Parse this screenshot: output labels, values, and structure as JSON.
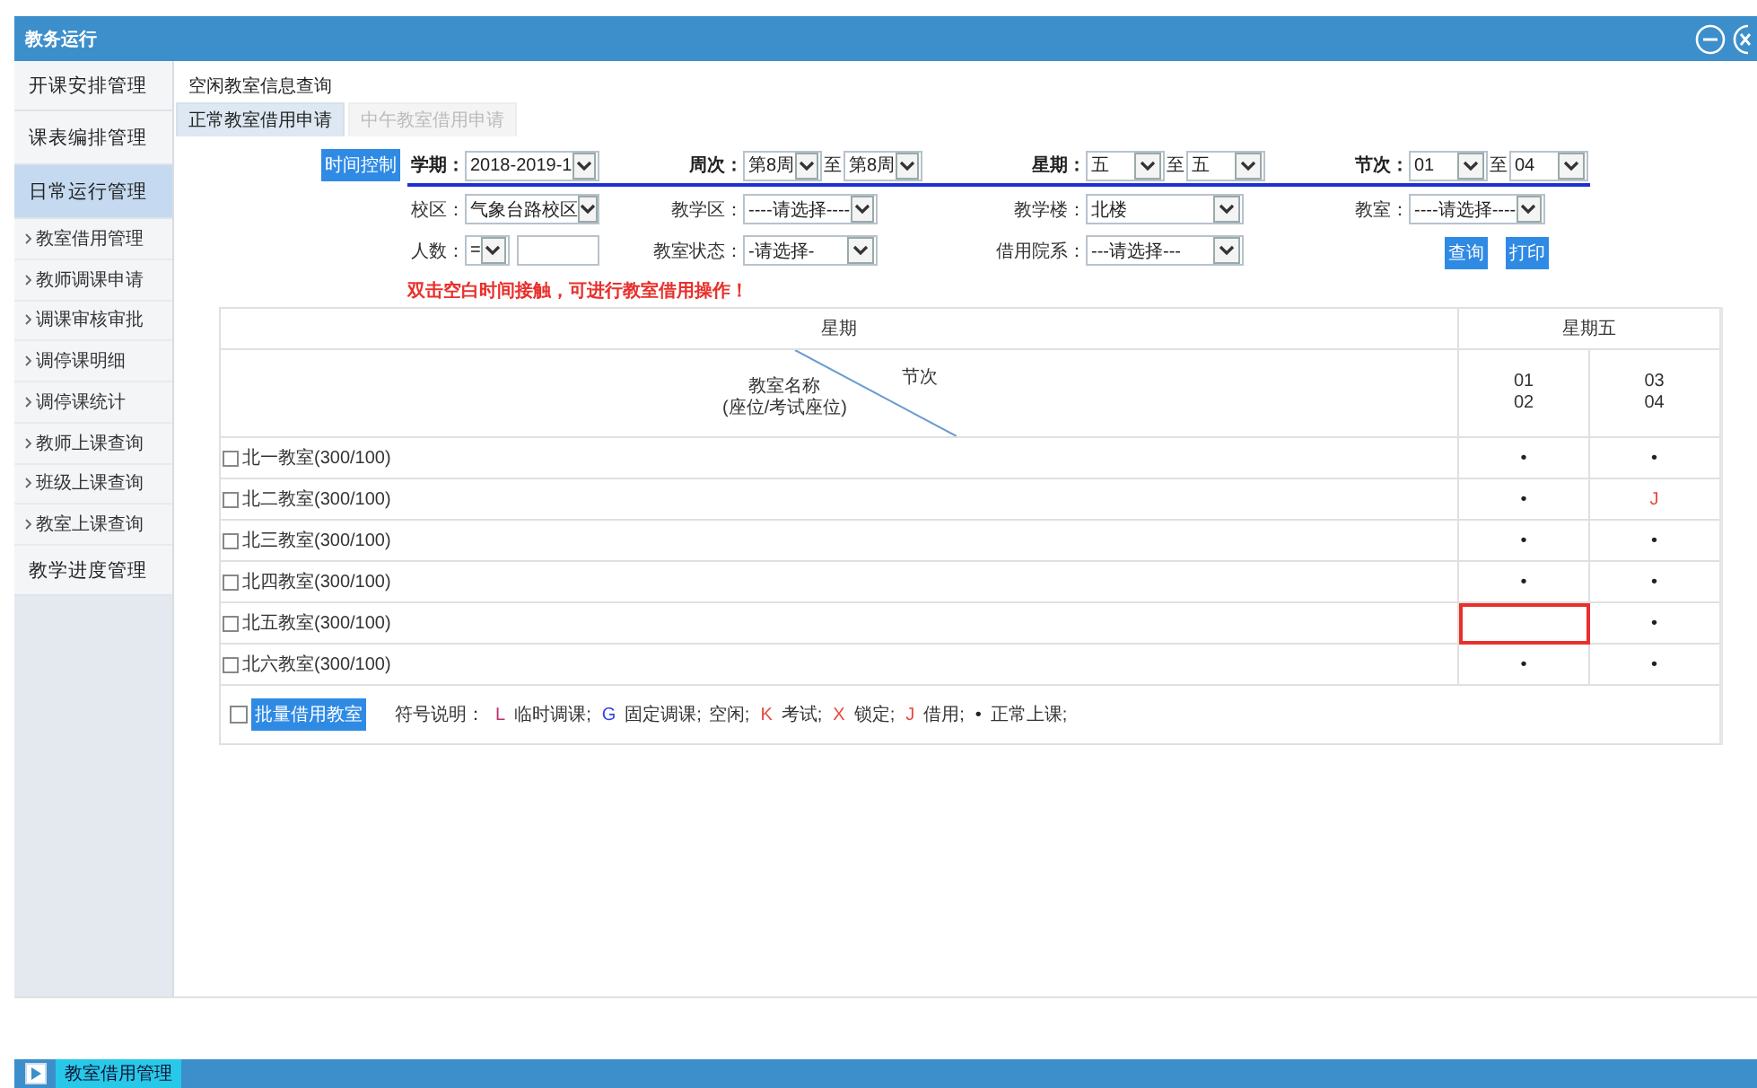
{
  "window": {
    "title": "教务运行"
  },
  "sidebar": {
    "items": [
      {
        "label": "开课安排管理",
        "selected": false
      },
      {
        "label": "课表编排管理",
        "selected": false
      },
      {
        "label": "日常运行管理",
        "selected": true,
        "children": [
          {
            "label": "教室借用管理",
            "selected": false
          },
          {
            "label": "教师调课申请",
            "selected": false
          },
          {
            "label": "调课审核审批",
            "selected": false
          },
          {
            "label": "调停课明细",
            "selected": false
          },
          {
            "label": "调停课统计",
            "selected": false
          },
          {
            "label": "教师上课查询",
            "selected": false
          },
          {
            "label": "班级上课查询",
            "selected": false
          },
          {
            "label": "教室上课查询",
            "selected": false
          }
        ]
      },
      {
        "label": "教学进度管理",
        "selected": false
      }
    ]
  },
  "breadcrumb": "空闲教室信息查询",
  "tabs": [
    {
      "label": "正常教室借用申请",
      "selected": true
    },
    {
      "label": "中午教室借用申请",
      "selected": false
    }
  ],
  "form": {
    "time_control_button": "时间控制",
    "rows": [
      [
        {
          "label": "学期：",
          "kind": "select",
          "value": "2018-2019-1"
        },
        {
          "label": "周次：",
          "kind": "range",
          "from": "第8周",
          "separator": "至",
          "to": "第8周"
        },
        {
          "label": "星期：",
          "kind": "range",
          "from": "五",
          "separator": "至",
          "to": "五"
        },
        {
          "label": "节次：",
          "kind": "range",
          "from": "01",
          "separator": "至",
          "to": "04"
        }
      ],
      [
        {
          "label": "校区：",
          "kind": "select",
          "value": "气象台路校区"
        },
        {
          "label": "教学区：",
          "kind": "select",
          "value": "----请选择----"
        },
        {
          "label": "教学楼：",
          "kind": "select",
          "value": "北楼"
        },
        {
          "label": "教室：",
          "kind": "select",
          "value": "----请选择----"
        }
      ],
      [
        {
          "label": "人数：",
          "kind": "count",
          "operator": "="
        },
        {
          "label": "教室状态：",
          "kind": "select",
          "value": "-请选择-"
        },
        {
          "label": "借用院系：",
          "kind": "select",
          "value": "---请选择---"
        },
        {
          "kind": "buttons",
          "buttons": [
            "查询",
            "打印"
          ]
        }
      ]
    ]
  },
  "notice": "双击空白时间接触，可进行教室借用操作！",
  "table": {
    "header": "星期",
    "day": "星期五",
    "diagonal_top": "节次",
    "diagonal_bottom": "教室名称\n(座位/考试座位)",
    "periods": [
      "01\n02",
      "03\n04"
    ],
    "rows": [
      {
        "name": "北一教室(300/100)",
        "checked": false,
        "cells": [
          {
            "symbol": "•",
            "color": "#222222",
            "selected": false
          },
          {
            "symbol": "•",
            "color": "#222222",
            "selected": false
          }
        ]
      },
      {
        "name": "北二教室(300/100)",
        "checked": false,
        "cells": [
          {
            "symbol": "•",
            "color": "#222222",
            "selected": false
          },
          {
            "symbol": "J",
            "color": "#e8473c",
            "selected": false
          }
        ]
      },
      {
        "name": "北三教室(300/100)",
        "checked": false,
        "cells": [
          {
            "symbol": "•",
            "color": "#222222",
            "selected": false
          },
          {
            "symbol": "•",
            "color": "#222222",
            "selected": false
          }
        ]
      },
      {
        "name": "北四教室(300/100)",
        "checked": false,
        "cells": [
          {
            "symbol": "•",
            "color": "#222222",
            "selected": false
          },
          {
            "symbol": "•",
            "color": "#222222",
            "selected": false
          }
        ]
      },
      {
        "name": "北五教室(300/100)",
        "checked": false,
        "cells": [
          {
            "selected": true
          },
          {
            "symbol": "•",
            "color": "#222222",
            "selected": false
          }
        ]
      },
      {
        "name": "北六教室(300/100)",
        "checked": false,
        "cells": [
          {
            "symbol": "•",
            "color": "#222222",
            "selected": false
          },
          {
            "symbol": "•",
            "color": "#222222",
            "selected": false
          }
        ]
      }
    ],
    "batch": {
      "checked": false,
      "button": "批量借用教室"
    },
    "legend_title": "符号说明：",
    "legend": [
      {
        "symbol": "L",
        "color": "#c0306a",
        "label": "临时调课;"
      },
      {
        "symbol": "G",
        "color": "#3344dd",
        "label": "固定调课;"
      },
      {
        "label": "空闲;"
      },
      {
        "symbol": "K",
        "color": "#e8473c",
        "label": "考试;"
      },
      {
        "symbol": "X",
        "color": "#e8473c",
        "label": "锁定;"
      },
      {
        "symbol": "J",
        "color": "#e8473c",
        "label": "借用;"
      },
      {
        "symbol": "•",
        "color": "#222222",
        "label": "正常上课;"
      }
    ]
  },
  "bottom_bar": {
    "tabs": [
      {
        "label": "教室借用管理",
        "selected": true
      }
    ]
  }
}
